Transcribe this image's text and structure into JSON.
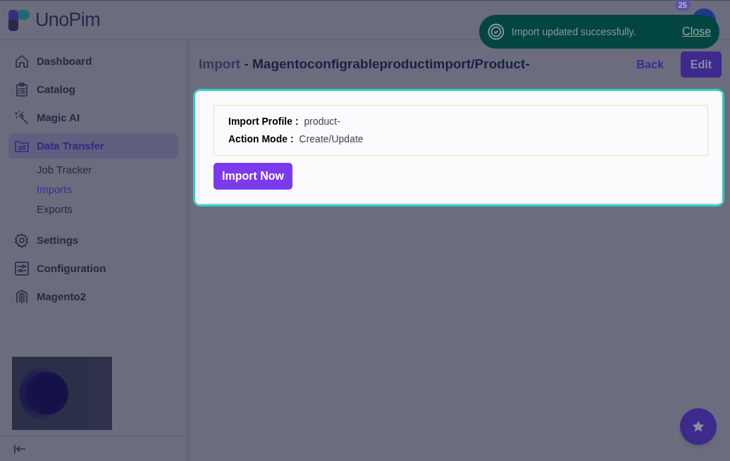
{
  "logo": {
    "text": "UnoPim"
  },
  "header": {
    "notification_count": "25"
  },
  "toast": {
    "message": "Import updated successfully.",
    "action": "Close"
  },
  "sidebar": {
    "items": [
      {
        "label": "Dashboard",
        "selected": false
      },
      {
        "label": "Catalog",
        "selected": false
      },
      {
        "label": "Magic AI",
        "selected": false
      },
      {
        "label": "Data Transfer",
        "selected": true,
        "children": [
          {
            "label": "Job Tracker",
            "selected": false
          },
          {
            "label": "Imports",
            "selected": true
          },
          {
            "label": "Exports",
            "selected": false
          }
        ]
      },
      {
        "label": "Settings",
        "selected": false
      },
      {
        "label": "Configuration",
        "selected": false
      },
      {
        "label": "Magento2",
        "selected": false
      }
    ]
  },
  "page": {
    "title": {
      "section": "Import",
      "name": "- Magentoconfigrableproductimport/Product-"
    },
    "actions": [
      {
        "label": "Back",
        "kind": "link"
      },
      {
        "label": "Edit",
        "kind": "primary"
      }
    ],
    "details": [
      {
        "label": "Import Profile :",
        "value": "product-"
      },
      {
        "label": "Action Mode :",
        "value": "Create/Update"
      }
    ],
    "run_button": "Import Now"
  }
}
